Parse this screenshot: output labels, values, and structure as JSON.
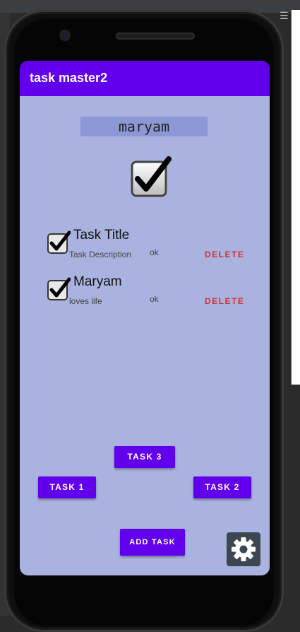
{
  "app": {
    "title": "task master2"
  },
  "user": {
    "name": "maryam"
  },
  "tasks": [
    {
      "title": "Task Title",
      "description": "Task Description",
      "state": "ok",
      "delete_label": "DELETE",
      "checked": true
    },
    {
      "title": "Maryam",
      "description": "loves life",
      "state": "ok",
      "delete_label": "DELETE",
      "checked": true
    }
  ],
  "buttons": {
    "task3": "TASK 3",
    "task1": "TASK 1",
    "task2": "TASK 2",
    "add_task": "ADD TASK"
  },
  "icons": {
    "menu": "hamburger-menu-icon",
    "settings": "gear-icon",
    "checkbox": "checkbox-checked-icon"
  },
  "colors": {
    "appbar": "#6200ee",
    "screen_bg": "#aab3df",
    "username_bg": "#8c98d6",
    "delete": "#d32f2f",
    "settings_bg": "#3c4650"
  }
}
